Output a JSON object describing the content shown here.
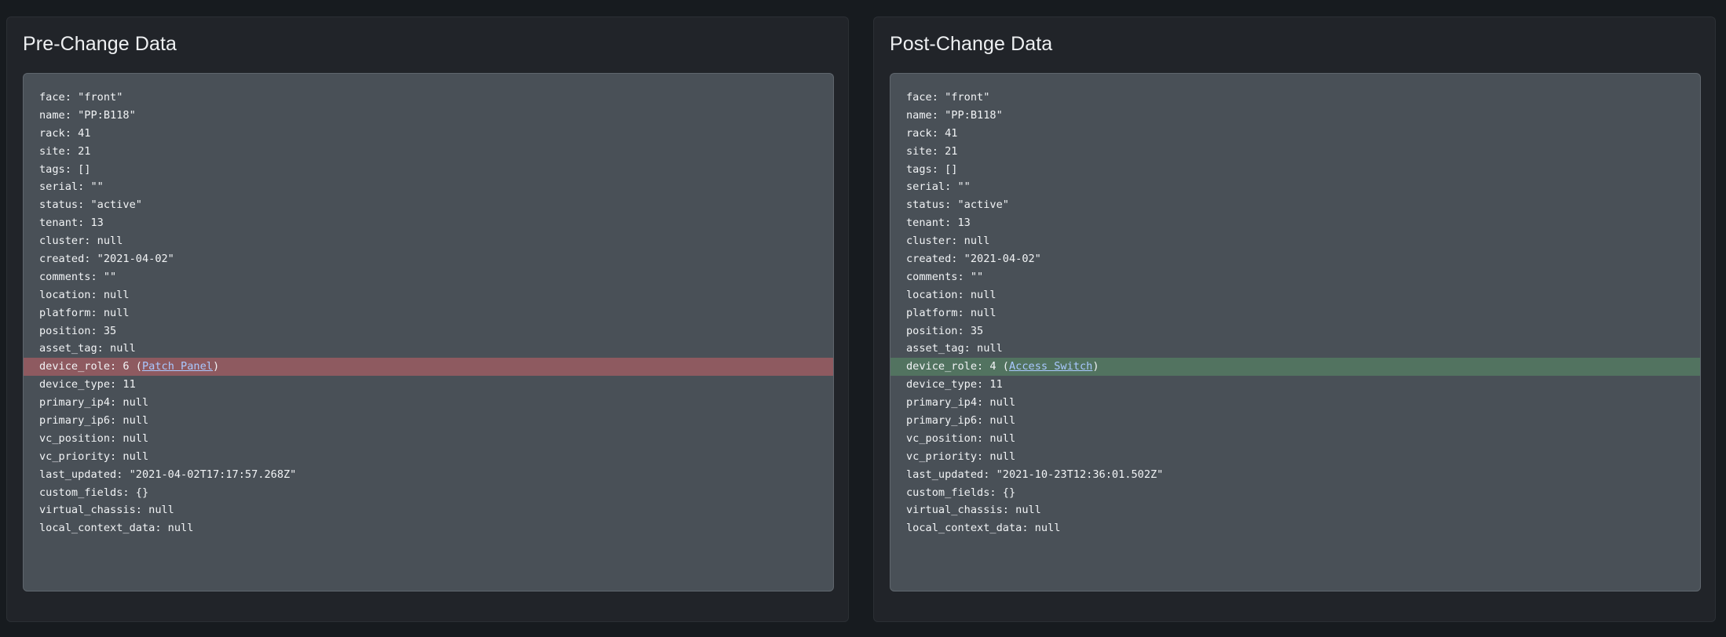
{
  "pre": {
    "title": "Pre-Change Data",
    "lines": [
      {
        "text": "face: \"front\""
      },
      {
        "text": "name: \"PP:B118\""
      },
      {
        "text": "rack: 41"
      },
      {
        "text": "site: 21"
      },
      {
        "text": "tags: []"
      },
      {
        "text": "serial: \"\""
      },
      {
        "text": "status: \"active\""
      },
      {
        "text": "tenant: 13"
      },
      {
        "text": "cluster: null"
      },
      {
        "text": "created: \"2021-04-02\""
      },
      {
        "text": "comments: \"\""
      },
      {
        "text": "location: null"
      },
      {
        "text": "platform: null"
      },
      {
        "text": "position: 35"
      },
      {
        "text": "asset_tag: null"
      },
      {
        "text": "device_role: 6 (",
        "link": "Patch Panel",
        "suffix": ")",
        "highlight": "removed"
      },
      {
        "text": "device_type: 11"
      },
      {
        "text": "primary_ip4: null"
      },
      {
        "text": "primary_ip6: null"
      },
      {
        "text": "vc_position: null"
      },
      {
        "text": "vc_priority: null"
      },
      {
        "text": "last_updated: \"2021-04-02T17:17:57.268Z\""
      },
      {
        "text": "custom_fields: {}"
      },
      {
        "text": "virtual_chassis: null"
      },
      {
        "text": "local_context_data: null"
      }
    ]
  },
  "post": {
    "title": "Post-Change Data",
    "lines": [
      {
        "text": "face: \"front\""
      },
      {
        "text": "name: \"PP:B118\""
      },
      {
        "text": "rack: 41"
      },
      {
        "text": "site: 21"
      },
      {
        "text": "tags: []"
      },
      {
        "text": "serial: \"\""
      },
      {
        "text": "status: \"active\""
      },
      {
        "text": "tenant: 13"
      },
      {
        "text": "cluster: null"
      },
      {
        "text": "created: \"2021-04-02\""
      },
      {
        "text": "comments: \"\""
      },
      {
        "text": "location: null"
      },
      {
        "text": "platform: null"
      },
      {
        "text": "position: 35"
      },
      {
        "text": "asset_tag: null"
      },
      {
        "text": "device_role: 4 (",
        "link": "Access Switch",
        "suffix": ")",
        "highlight": "added"
      },
      {
        "text": "device_type: 11"
      },
      {
        "text": "primary_ip4: null"
      },
      {
        "text": "primary_ip6: null"
      },
      {
        "text": "vc_position: null"
      },
      {
        "text": "vc_priority: null"
      },
      {
        "text": "last_updated: \"2021-10-23T12:36:01.502Z\""
      },
      {
        "text": "custom_fields: {}"
      },
      {
        "text": "virtual_chassis: null"
      },
      {
        "text": "local_context_data: null"
      }
    ]
  },
  "colors": {
    "removed_highlight": "#8e5a60",
    "added_highlight": "#527360",
    "link": "#a9c8ff"
  }
}
